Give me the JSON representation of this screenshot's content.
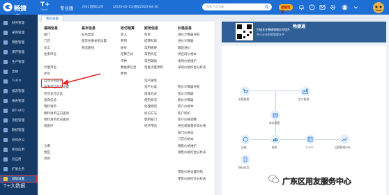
{
  "header": {
    "logo_text": "畅捷通",
    "product": "T+",
    "product_sub": "Cloud",
    "edition": "专业版",
    "company": "[001]测试公司",
    "period": "(2020-02-15)",
    "period_range": "测试2020-04-30",
    "search_placeholder": "搜索 产品功能",
    "sale_badge": "促销活动"
  },
  "tabs": [
    {
      "label": "我的桌面"
    }
  ],
  "sidebar": {
    "items": [
      {
        "label": "财务管理"
      },
      {
        "label": "采购管理"
      },
      {
        "label": "销售管理"
      },
      {
        "label": "库存管理"
      },
      {
        "label": "生产管理"
      },
      {
        "label": "出纳"
      },
      {
        "label": "T-UFO"
      },
      {
        "label": "报表管理"
      },
      {
        "label": "报表管理"
      },
      {
        "label": "新T-UFO"
      },
      {
        "label": "流程管理"
      },
      {
        "label": "期初管理"
      },
      {
        "label": "协同办公"
      },
      {
        "label": "移动应用"
      },
      {
        "label": "云应用"
      },
      {
        "label": "扩展业务"
      },
      {
        "label": "基础设置"
      }
    ],
    "active_index": 16
  },
  "menu": {
    "columns": [
      {
        "header": "基础信息",
        "items": [
          "部门",
          "门店",
          "员工",
          "往来单位",
          "",
          "计量单位",
          "存货",
          "自动识别影响",
          "往来单位存货设置",
          "存货多元信息",
          "电商信息",
          "物料清单",
          "物料清单正向查询",
          "物料清单反向查询",
          "成套件",
          "",
          "",
          "仓库",
          "地区",
          "项目"
        ]
      },
      {
        "header": "基本信息",
        "items": [
          "业务类型",
          "配货往来关系设置",
          "物流路线"
        ]
      },
      {
        "header": "收付结算",
        "items": [
          "收入",
          "费用",
          "账号",
          "结算方式",
          "币种",
          "数据库信息",
          "费用"
        ]
      },
      {
        "header": "财务信息",
        "items": [
          "科目",
          "结转科目",
          "常用摘要",
          "常用凭证",
          "常用辅助",
          "现金流量项目",
          "",
          "资产属性",
          "资产分类",
          "增减方式",
          "使用状况",
          "处理原因",
          "折旧方法",
          "使用部门",
          "经济用途"
        ]
      },
      {
        "header": "价格信息",
        "items": [
          "进价计算器导航",
          "进价计算器",
          "最新进价",
          "供应商价格本",
          "采购价格维护",
          "采购价格综合分析表",
          "",
          "",
          "售价计算器导航",
          "售价计算器",
          "售价计算器",
          "客户价格本",
          "客户折扣",
          "客户价格调整",
          "供应商数量折扣价格",
          "部门价格本",
          "门店价格本",
          "销售价格维护",
          "销售价格综合分析表",
          "",
          "",
          "零售价格设置导航",
          "零售价格综合分析表"
        ]
      }
    ]
  },
  "banner": {
    "line1": "扫描关注畅捷通服务号提升",
    "line2": "中小企业财税管理水平",
    "logo": "畅捷通"
  },
  "flow": {
    "nodes": [
      "采购管理",
      "生产管理",
      "库存管理",
      "出纳",
      "报表",
      "T-UFO",
      "运营管理分析",
      "移动应用"
    ]
  },
  "watermark": {
    "cart": "T+大数据",
    "bottom": "广东区用友服务中心"
  },
  "colors": {
    "primary": "#1d6fd6",
    "sidebar": "#163a66",
    "highlight": "#e12424"
  }
}
